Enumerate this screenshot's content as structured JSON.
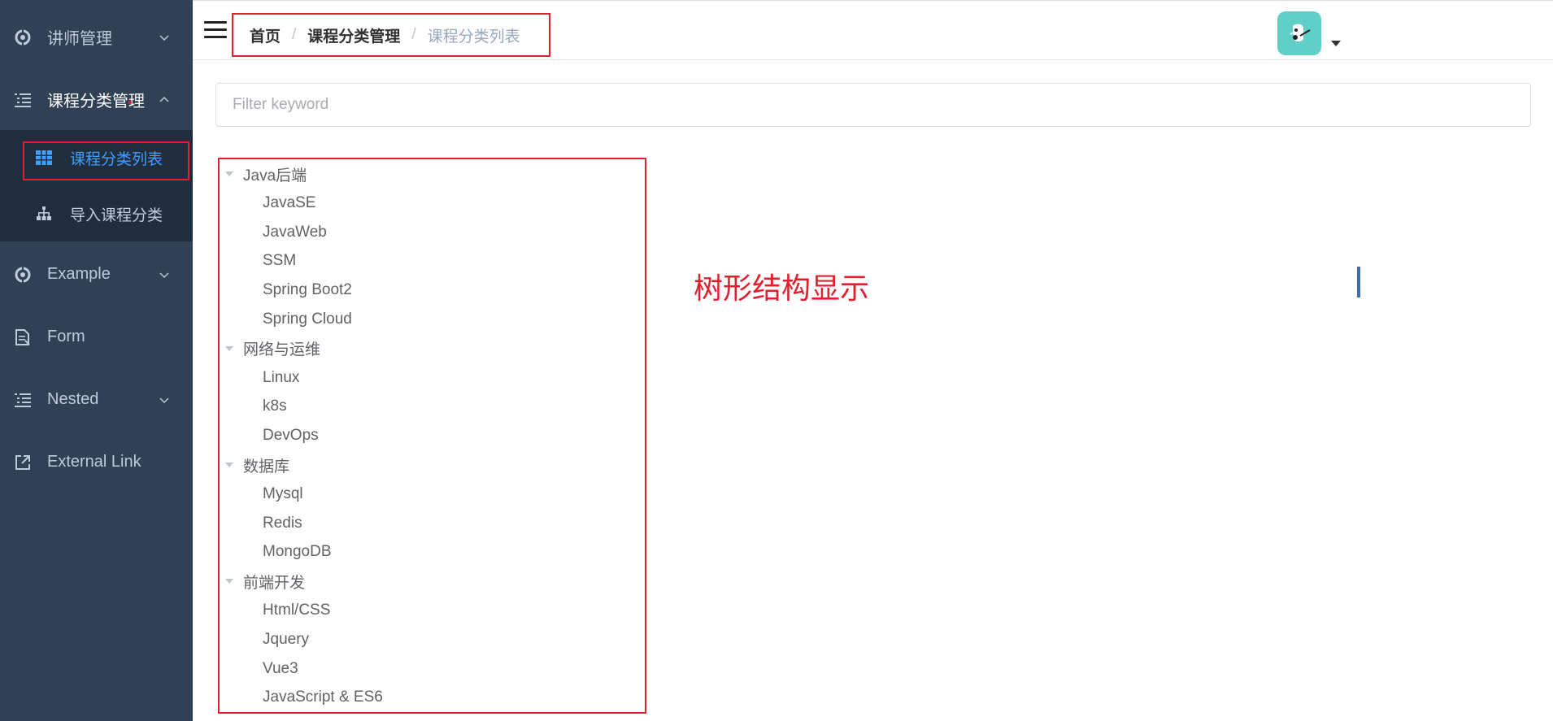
{
  "sidebar": {
    "items": [
      {
        "label": "讲师管理",
        "icon": "target-icon"
      },
      {
        "label": "课程分类管理",
        "icon": "list-icon"
      },
      {
        "label": "Example",
        "icon": "target-icon"
      },
      {
        "label": "Form",
        "icon": "document-icon"
      },
      {
        "label": "Nested",
        "icon": "list-icon"
      },
      {
        "label": "External Link",
        "icon": "external-link-icon"
      }
    ],
    "submenu": [
      {
        "label": "课程分类列表",
        "icon": "table-icon"
      },
      {
        "label": "导入课程分类",
        "icon": "tree-icon"
      }
    ],
    "colors": {
      "background": "#304156",
      "submenu_background": "#1f2d3d",
      "active": "#409eff",
      "text": "#bfcbd9"
    }
  },
  "navbar": {
    "breadcrumb": [
      "首页",
      "课程分类管理",
      "课程分类列表"
    ],
    "separator": "/"
  },
  "filter": {
    "placeholder": "Filter keyword",
    "value": ""
  },
  "tree": [
    {
      "label": "Java后端",
      "children": [
        "JavaSE",
        "JavaWeb",
        "SSM",
        "Spring Boot2",
        "Spring Cloud"
      ]
    },
    {
      "label": "网络与运维",
      "children": [
        "Linux",
        "k8s",
        "DevOps"
      ]
    },
    {
      "label": "数据库",
      "children": [
        "Mysql",
        "Redis",
        "MongoDB"
      ]
    },
    {
      "label": "前端开发",
      "children": [
        "Html/CSS",
        "Jquery",
        "Vue3",
        "JavaScript & ES6"
      ]
    }
  ],
  "annotation": "树形结构显示",
  "colors": {
    "annotation_red": "#e0202e"
  }
}
